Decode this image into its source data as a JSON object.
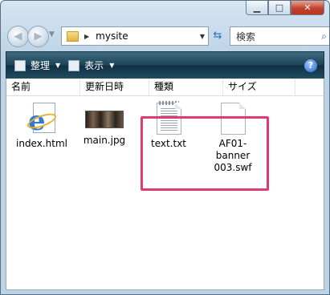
{
  "window": {
    "caption_buttons": [
      "minimize",
      "maximize",
      "close"
    ]
  },
  "navigation": {
    "address_path": "mysite",
    "search_placeholder": "検索"
  },
  "toolbar": {
    "organize_label": "整理",
    "view_label": "表示",
    "help_label": "?"
  },
  "columns": [
    "名前",
    "更新日時",
    "種類",
    "サイズ"
  ],
  "files": [
    {
      "name": "index.html",
      "icon": "internet-explorer-html-icon"
    },
    {
      "name": "main.jpg",
      "icon": "jpg-thumbnail-icon"
    },
    {
      "name": "text.txt",
      "icon": "text-document-icon"
    },
    {
      "name": "AF01-banner 003.swf",
      "line1": "AF01-banner",
      "line2": "003.swf",
      "icon": "blank-document-icon"
    }
  ],
  "colors": {
    "highlight": "#e03a76",
    "toolbar": "#1c4256",
    "frame": "#bcd3e6"
  }
}
